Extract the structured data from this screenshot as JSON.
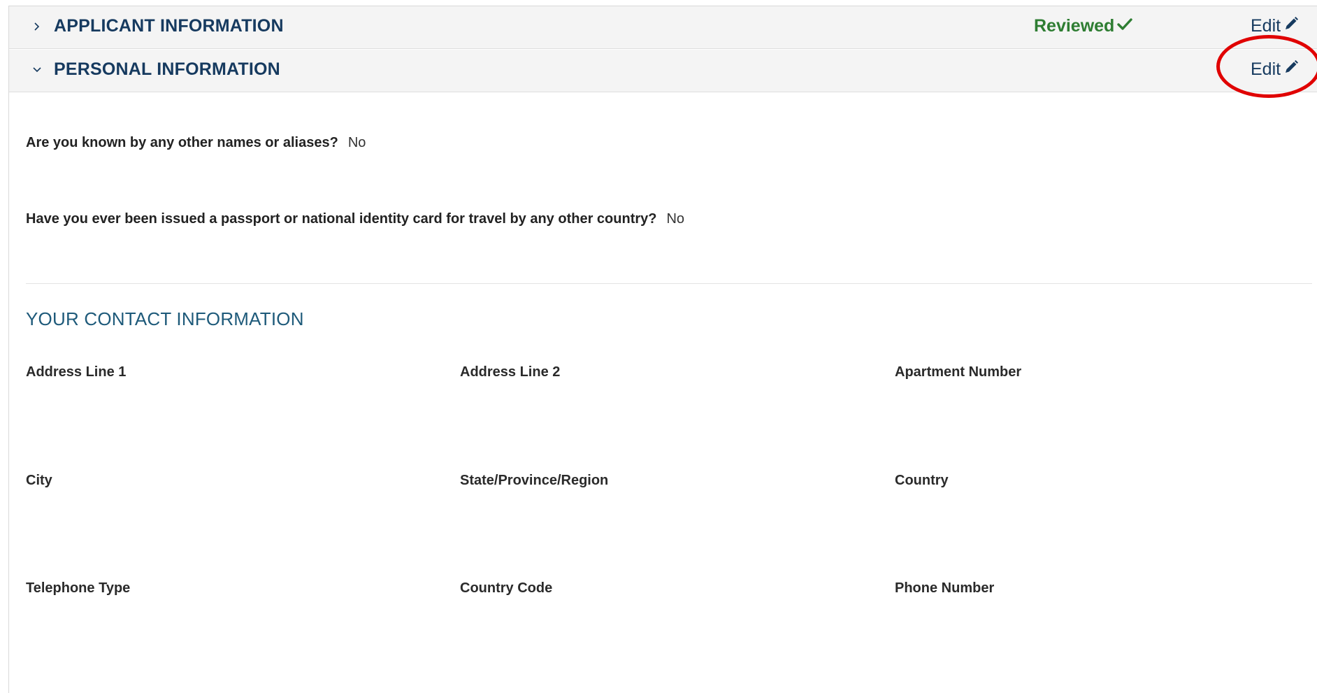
{
  "accordion": {
    "applicant": {
      "title": "APPLICANT INFORMATION",
      "status": "Reviewed",
      "edit_label": "Edit",
      "expanded": false
    },
    "personal": {
      "title": "PERSONAL INFORMATION",
      "edit_label": "Edit",
      "expanded": true
    }
  },
  "questions": [
    {
      "text": "Are you known by any other names or aliases?",
      "answer": "No"
    },
    {
      "text": "Have you ever been issued a passport or national identity card for travel by any other country?",
      "answer": "No"
    }
  ],
  "contact": {
    "section_title": "YOUR CONTACT INFORMATION",
    "fields": {
      "address_line_1": "Address Line 1",
      "address_line_2": "Address Line 2",
      "apartment_number": "Apartment Number",
      "city": "City",
      "state": "State/Province/Region",
      "country": "Country",
      "telephone_type": "Telephone Type",
      "country_code": "Country Code",
      "phone_number": "Phone Number"
    }
  },
  "colors": {
    "header_text": "#163a5f",
    "section_title": "#1e5a7a",
    "reviewed": "#2e7d32",
    "annotation": "#e00000",
    "header_bg": "#f4f4f4"
  },
  "icons": {
    "collapsed": "chevron-right-icon",
    "expanded": "chevron-down-icon",
    "reviewed": "checkmark-icon",
    "edit": "pencil-icon"
  }
}
